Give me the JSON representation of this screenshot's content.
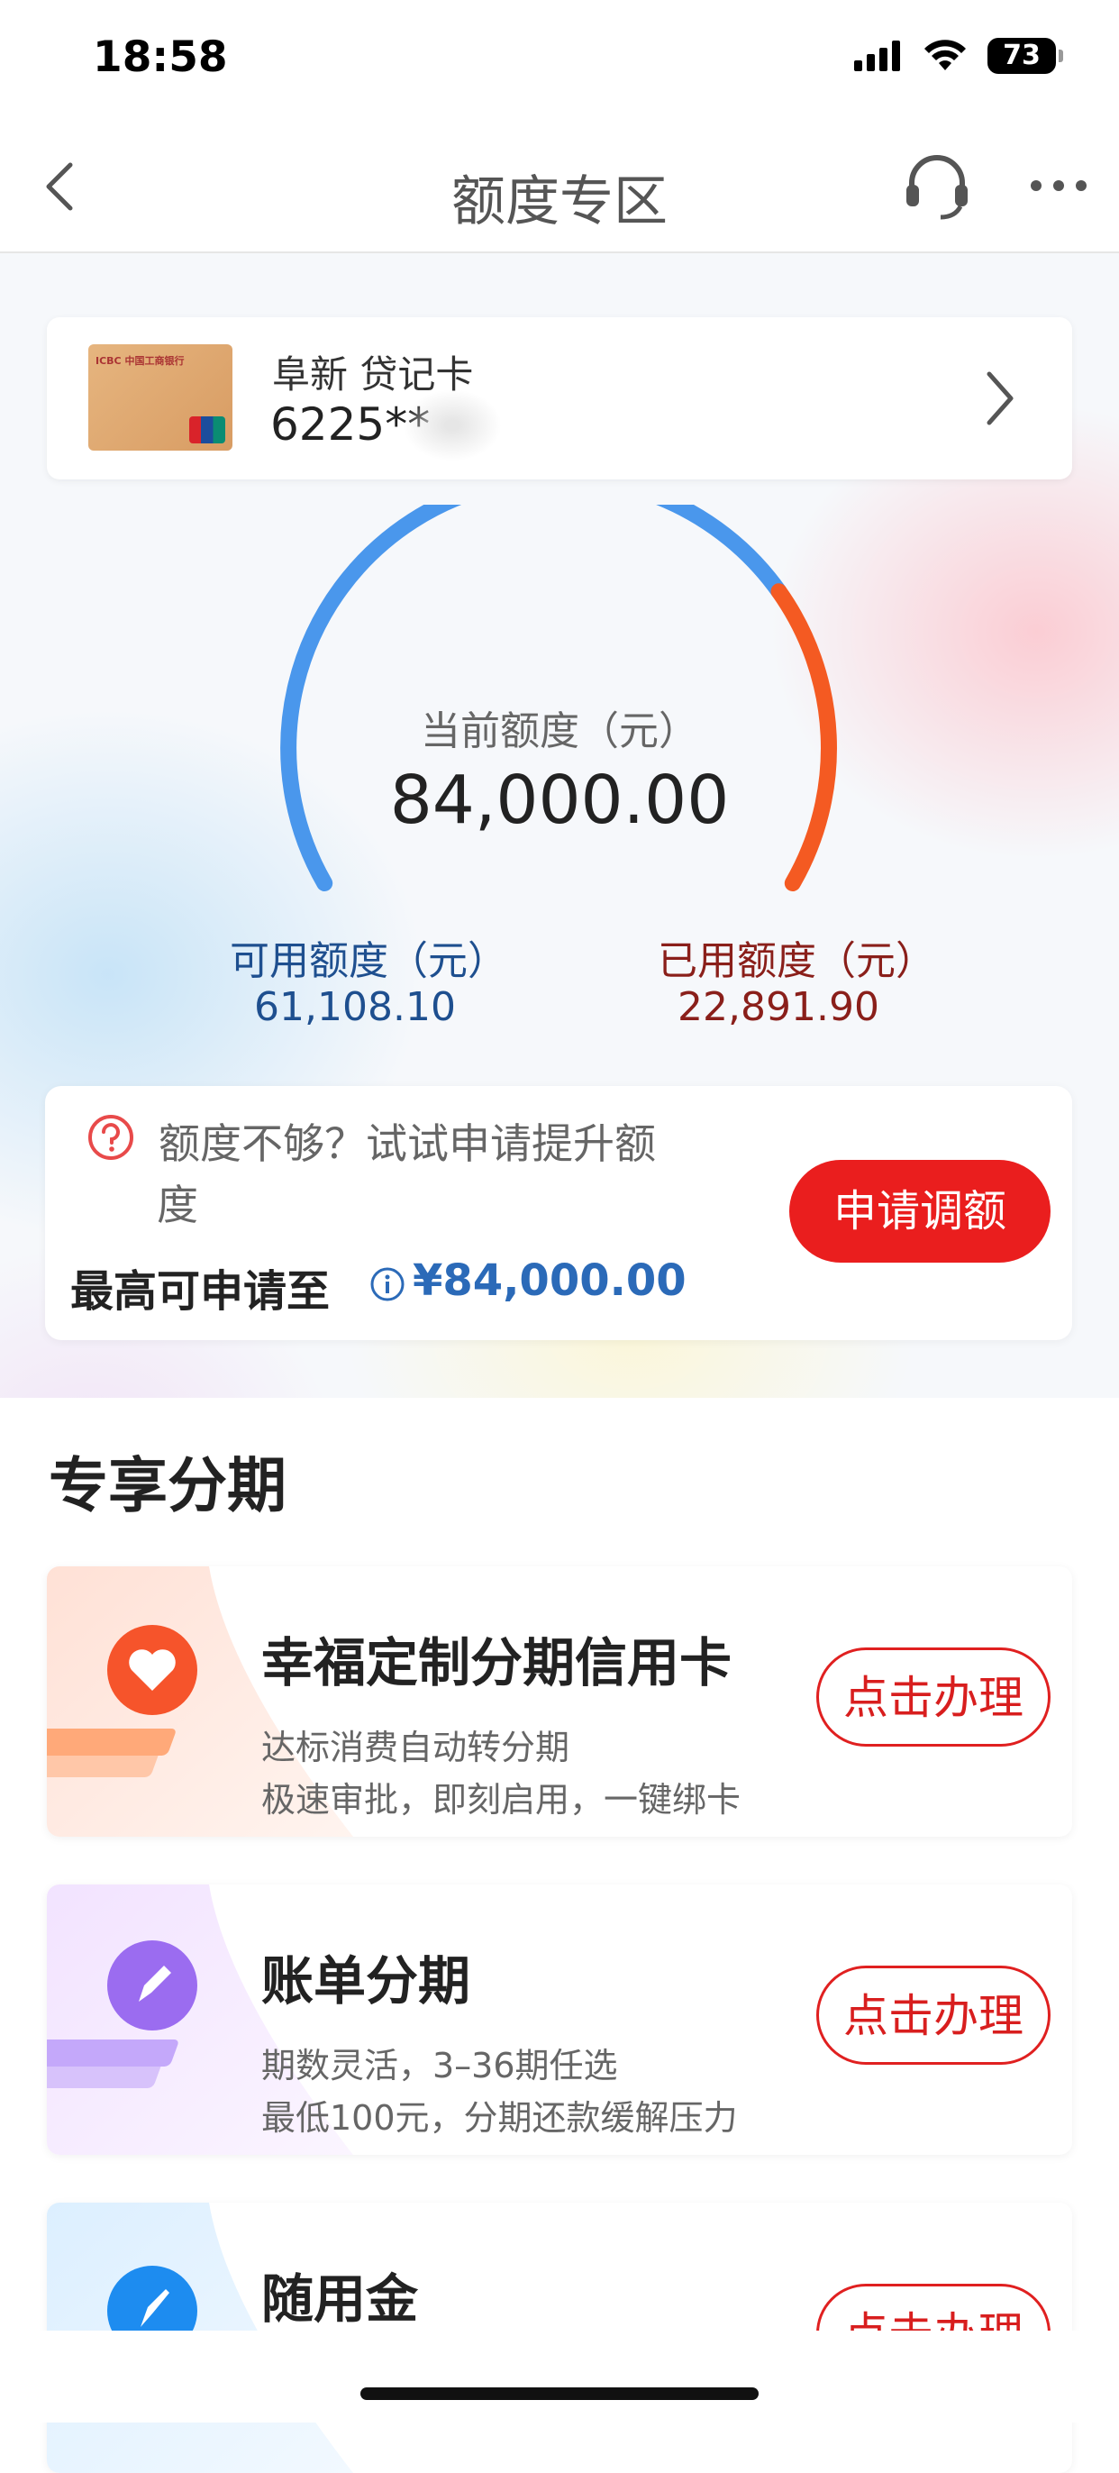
{
  "status_bar": {
    "time": "18:58",
    "battery": "73"
  },
  "nav": {
    "title": "额度专区"
  },
  "card": {
    "name": "阜新 贷记卡",
    "number": "6225**",
    "bank_text": "ICBC 中国工商银行"
  },
  "gauge": {
    "current_label": "当前额度（元）",
    "current_value": "84,000.00",
    "available_label": "可用额度（元）",
    "available_value": "61,108.10",
    "used_label": "已用额度（元）",
    "used_value": "22,891.90",
    "used_fraction": 0.2725,
    "colors": {
      "available": "#4a97ec",
      "used": "#f45a22"
    }
  },
  "apply": {
    "hint_line1": "额度不够？试试申请提升额",
    "hint_line2": "度",
    "max_label": "最高可申请至",
    "max_value": "¥84,000.00",
    "button": "申请调额"
  },
  "section": {
    "title": "专享分期"
  },
  "promos": [
    {
      "title": "幸福定制分期信用卡",
      "sub1": "达标消费自动转分期",
      "sub2": "极速审批，即刻启用，一键绑卡",
      "button": "点击办理"
    },
    {
      "title": "账单分期",
      "sub1": "期数灵活，3–36期任选",
      "sub2": "最低100元，分期还款缓解压力",
      "button": "点击办理"
    },
    {
      "title": "随用金",
      "sub1": "",
      "sub2": "",
      "button": "点击办理"
    }
  ]
}
